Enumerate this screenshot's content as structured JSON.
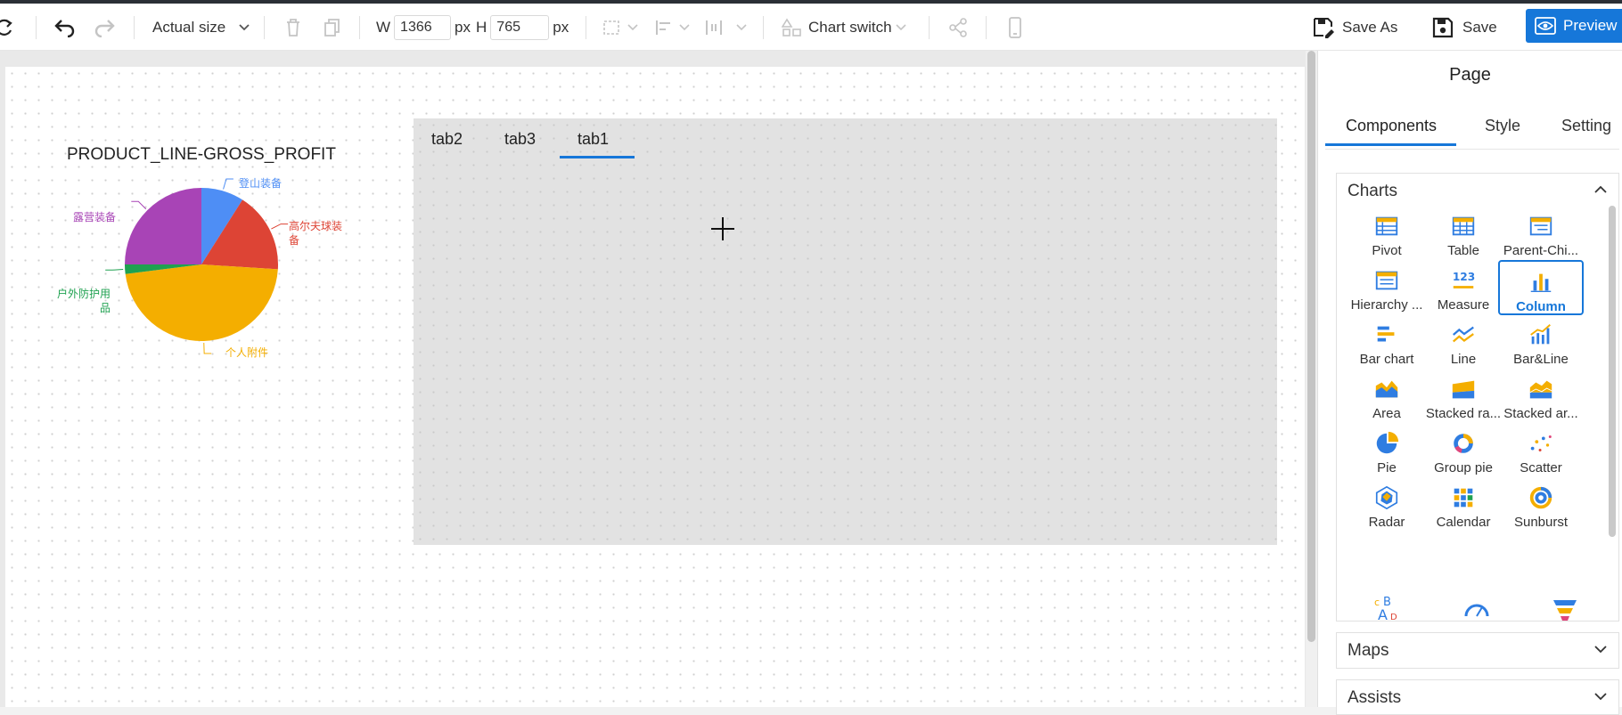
{
  "toolbar": {
    "zoom_label": "Actual size",
    "width_label": "W",
    "width_value": "1366",
    "width_unit": "px",
    "height_label": "H",
    "height_value": "765",
    "height_unit": "px",
    "chart_switch_label": "Chart switch",
    "save_as_label": "Save As",
    "save_label": "Save",
    "preview_label": "Preview"
  },
  "canvas": {
    "chart_title": "PRODUCT_LINE-GROSS_PROFIT",
    "pie": {
      "slices": [
        {
          "label": "登山装备",
          "color": "#4e8ef5",
          "share": 0.09
        },
        {
          "label": "高尔夫球装备",
          "color": "#dd4435",
          "share": 0.17
        },
        {
          "label": "个人附件",
          "color": "#f4ae00",
          "share": 0.47
        },
        {
          "label": "户外防护用品",
          "color": "#1fa150",
          "share": 0.02
        },
        {
          "label": "露营装备",
          "color": "#a844b6",
          "share": 0.25
        }
      ]
    },
    "tabs": [
      "tab2",
      "tab3",
      "tab1"
    ],
    "active_tab": "tab1"
  },
  "panel": {
    "title": "Page",
    "tabs": [
      "Components",
      "Style",
      "Setting"
    ],
    "active_tab": "Components",
    "sections": {
      "charts": "Charts",
      "maps": "Maps",
      "assists": "Assists"
    },
    "components": [
      {
        "label": "Pivot",
        "icon": "pivot-icon"
      },
      {
        "label": "Table",
        "icon": "table-icon"
      },
      {
        "label": "Parent-Chi...",
        "icon": "parent-child-icon"
      },
      {
        "label": "Hierarchy ...",
        "icon": "hierarchy-icon"
      },
      {
        "label": "Measure",
        "icon": "measure-icon"
      },
      {
        "label": "Column",
        "icon": "column-icon"
      },
      {
        "label": "Bar chart",
        "icon": "bar-chart-icon"
      },
      {
        "label": "Line",
        "icon": "line-icon"
      },
      {
        "label": "Bar&Line",
        "icon": "bar-line-icon"
      },
      {
        "label": "Area",
        "icon": "area-icon"
      },
      {
        "label": "Stacked ra...",
        "icon": "stacked-range-icon"
      },
      {
        "label": "Stacked ar...",
        "icon": "stacked-area-icon"
      },
      {
        "label": "Pie",
        "icon": "pie-icon"
      },
      {
        "label": "Group pie",
        "icon": "group-pie-icon"
      },
      {
        "label": "Scatter",
        "icon": "scatter-icon"
      },
      {
        "label": "Radar",
        "icon": "radar-icon"
      },
      {
        "label": "Calendar",
        "icon": "calendar-icon"
      },
      {
        "label": "Sunburst",
        "icon": "sunburst-icon"
      }
    ],
    "selected_component": "Column",
    "colors": {
      "accent": "#1677d9",
      "blue": "#2f7de1",
      "orange": "#f4ae00"
    }
  }
}
